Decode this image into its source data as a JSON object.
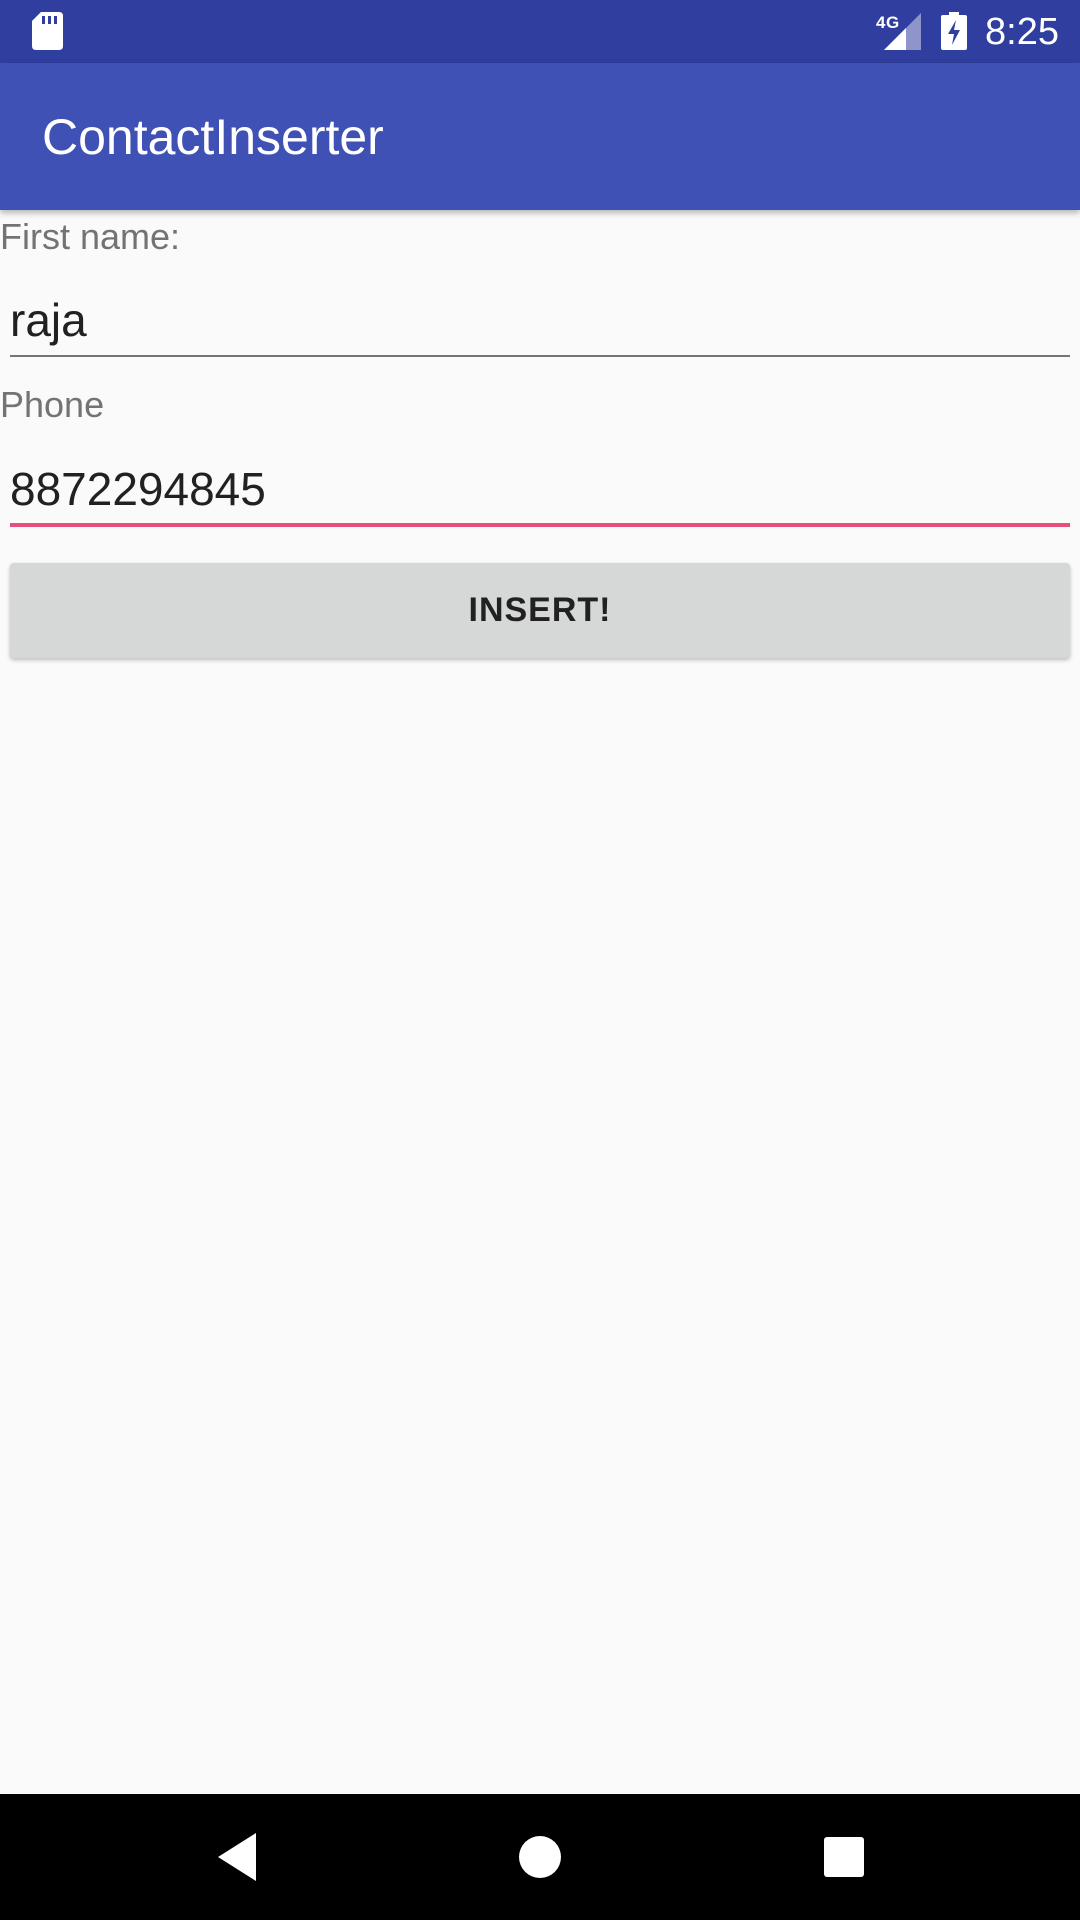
{
  "status_bar": {
    "network": "4G",
    "time": "8:25",
    "icons": [
      "sd-card-icon",
      "signal-icon",
      "battery-charging-icon"
    ]
  },
  "app_bar": {
    "title": "ContactInserter"
  },
  "form": {
    "first_name_label": "First name:",
    "first_name_value": "raja",
    "phone_label": "Phone",
    "phone_value": "8872294845",
    "insert_button_label": "INSERT!"
  },
  "nav_bar": {
    "icons": [
      "back-icon",
      "home-icon",
      "recent-apps-icon"
    ]
  },
  "colors": {
    "status_bar": "#303f9f",
    "primary": "#3f51b5",
    "accent": "#e94d7c",
    "background": "#fafafa",
    "button": "#d6d7d7"
  }
}
